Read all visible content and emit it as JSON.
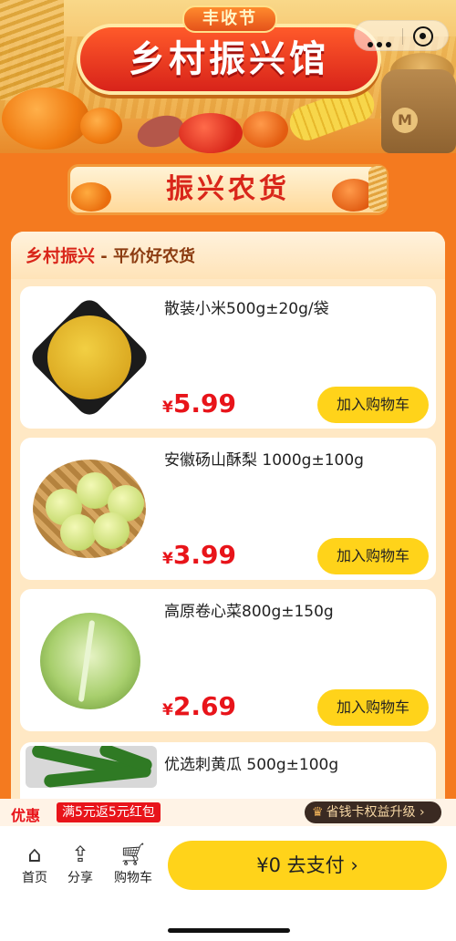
{
  "header": {
    "festival_tag": "丰收节",
    "main_title": "乡村振兴馆"
  },
  "section": {
    "title": "振兴农货"
  },
  "panel": {
    "title": "乡村振兴",
    "subtitle": " - 平价好农货"
  },
  "products": [
    {
      "name": "散装小米500g±20g/袋",
      "currency": "¥",
      "price": "5.99",
      "cart_label": "加入购物车",
      "image": "millet"
    },
    {
      "name": "安徽砀山酥梨 1000g±100g",
      "currency": "¥",
      "price": "3.99",
      "cart_label": "加入购物车",
      "image": "pears-basket"
    },
    {
      "name": "高原卷心菜800g±150g",
      "currency": "¥",
      "price": "2.69",
      "cart_label": "加入购物车",
      "image": "cabbage"
    },
    {
      "name": "优选刺黄瓜 500g±100g",
      "image": "cucumbers"
    }
  ],
  "promo": {
    "label": "优惠",
    "tag": "满5元返5元红包",
    "upgrade": "省钱卡权益升级",
    "upgrade_arrow": "›"
  },
  "tabbar": {
    "home": "首页",
    "share": "分享",
    "cart": "购物车",
    "pay_label": "¥0 去支付 ›"
  },
  "colors": {
    "background": "#f47a1f",
    "price": "#e8141a",
    "button": "#ffd31a",
    "title_red": "#d9261a"
  }
}
